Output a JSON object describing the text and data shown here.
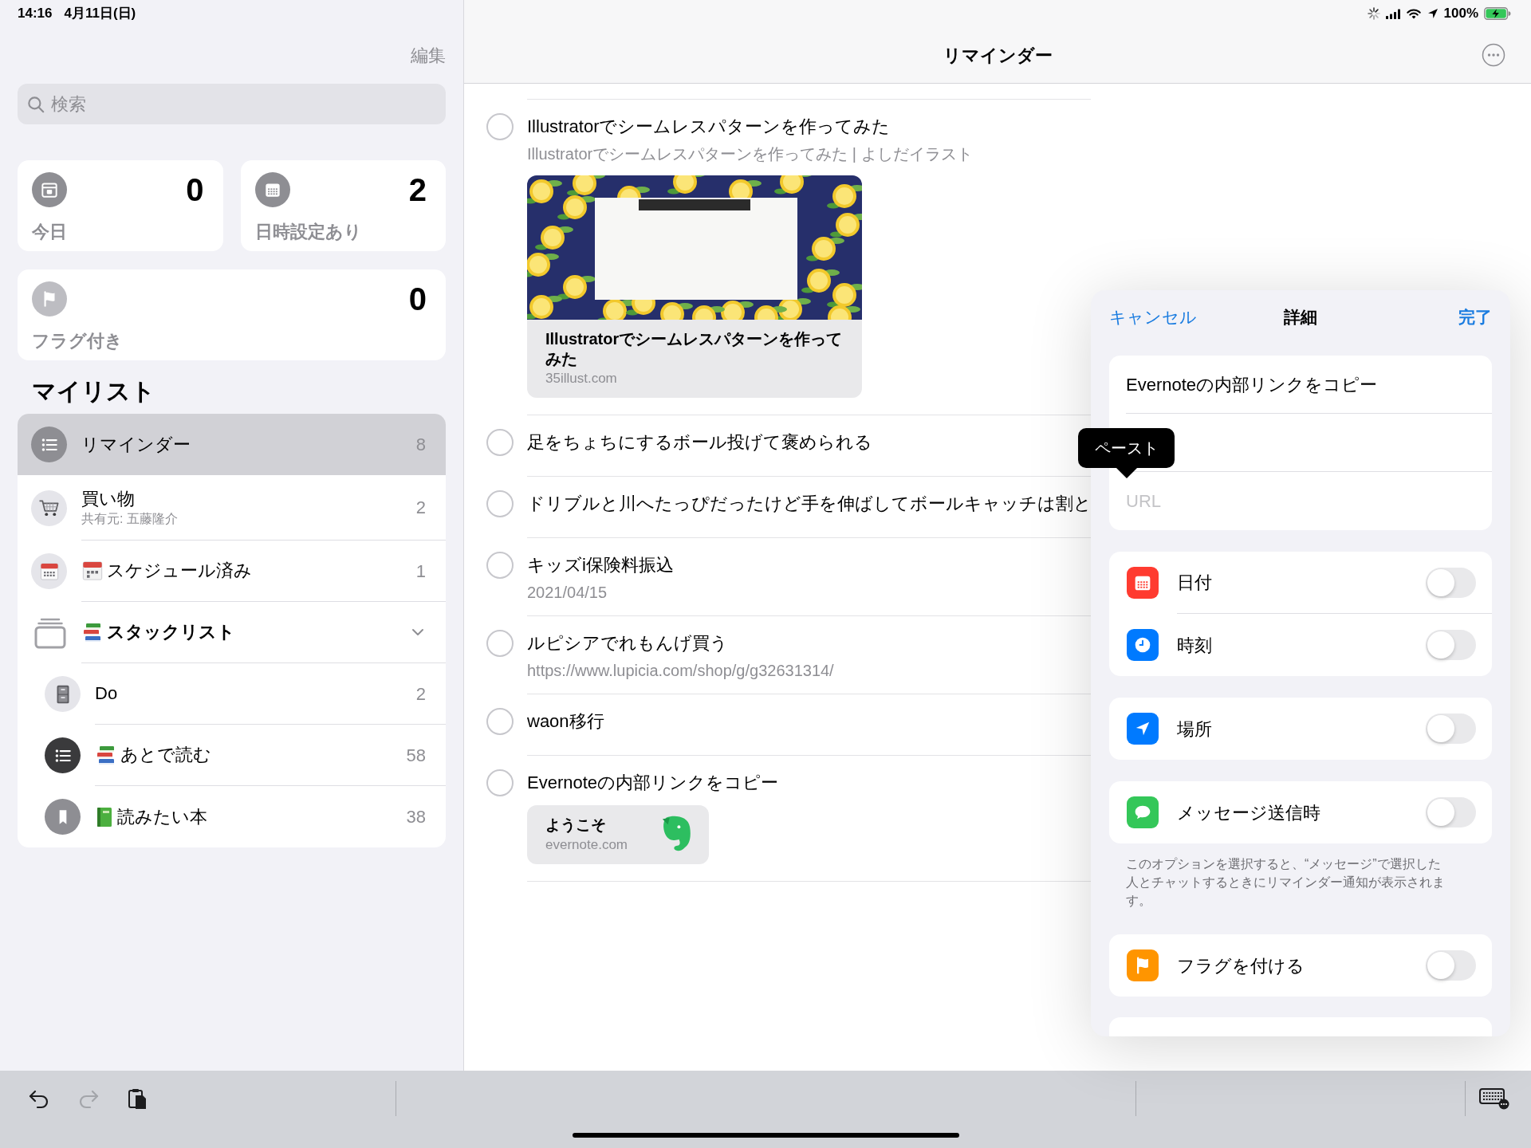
{
  "status_bar": {
    "time": "14:16",
    "date": "4月11日(日)",
    "battery": "100%"
  },
  "sidebar": {
    "edit": {
      "label": "編集",
      "disabled": true
    },
    "search": {
      "placeholder": "検索"
    },
    "smart_lists": [
      {
        "kind": "today",
        "label": "今日",
        "count": "0",
        "color": "#8e8e93"
      },
      {
        "kind": "scheduled",
        "label": "日時設定あり",
        "count": "2",
        "color": "#8e8e93"
      },
      {
        "kind": "flagged",
        "label": "フラグ付き",
        "count": "0",
        "color": "#bdbdc2"
      }
    ],
    "section_title": "マイリスト",
    "lists": [
      {
        "kind": "list",
        "name": "リマインダー",
        "count": "8",
        "selected": true,
        "color": "#8e8e93"
      },
      {
        "kind": "cart",
        "name": "買い物",
        "subtitle": "共有元: 五藤隆介",
        "count": "2",
        "selected": false,
        "color": "#e5e5ea"
      },
      {
        "kind": "calendar",
        "emoji_icon": {
          "kind": "calendar"
        },
        "name": "スケジュール済み",
        "count": "1",
        "selected": false,
        "color": "#e5e5ea"
      },
      {
        "kind": "group",
        "emoji_icon": {
          "kind": "books"
        },
        "name": "スタックリスト",
        "expanded": true,
        "selected": false,
        "children": [
          {
            "kind": "cabinet",
            "name": "Do",
            "count": "2",
            "selected": false,
            "color": "#e5e5ea"
          },
          {
            "kind": "list",
            "emoji_icon": {
              "kind": "books"
            },
            "name": "あとで読む",
            "count": "58",
            "selected": false,
            "color": "#3a3a3c"
          },
          {
            "kind": "bookmark",
            "emoji_icon": {
              "kind": "book"
            },
            "name": "読みたい本",
            "count": "38",
            "selected": false,
            "color": "#8e8e93"
          }
        ]
      }
    ]
  },
  "list_view": {
    "title": "リマインダー",
    "items": [
      {
        "title": "Illustratorでシームレスパターンを作ってみた",
        "completed": false,
        "subtitle": "Illustratorでシームレスパターンを作ってみた | よしだイラスト",
        "link_preview": {
          "kind": "image",
          "title": "Illustratorでシームレスパターンを作ってみた",
          "domain": "35illust.com"
        }
      },
      {
        "title": "足をちょちにするボール投げて褒められる",
        "completed": false
      },
      {
        "title": "ドリブルと川へたっぴだったけど手を伸ばしてボールキャッチは割と",
        "completed": false
      },
      {
        "title": "キッズi保険料振込",
        "completed": false,
        "subtitle": "2021/04/15"
      },
      {
        "title": "ルピシアでれもんげ買う",
        "completed": false,
        "subtitle": "https://www.lupicia.com/shop/g/g32631314/"
      },
      {
        "title": "waon移行",
        "completed": false
      },
      {
        "title": "Evernoteの内部リンクをコピー",
        "completed": false,
        "link_preview": {
          "kind": "compact",
          "title": "ようこそ",
          "domain": "evernote.com"
        }
      }
    ]
  },
  "detail_popover": {
    "cancel": "キャンセル",
    "title": "詳細",
    "done": "完了",
    "reminder_title": "Evernoteの内部リンクをコピー",
    "url": {
      "placeholder": "URL"
    },
    "groups": [
      {
        "rows": [
          {
            "kind": "date",
            "label": "日付",
            "on": false,
            "color": "#ff3b30"
          },
          {
            "kind": "time",
            "label": "時刻",
            "on": false,
            "color": "#007aff"
          }
        ]
      },
      {
        "rows": [
          {
            "kind": "location",
            "label": "場所",
            "on": false,
            "color": "#007aff"
          }
        ]
      },
      {
        "rows": [
          {
            "kind": "messages",
            "label": "メッセージ送信時",
            "on": false,
            "color": "#34c759"
          }
        ],
        "footnote": "このオプションを選択すると、“メッセージ”で選択した人とチャットするときにリマインダー通知が表示されます。"
      },
      {
        "rows": [
          {
            "kind": "flag",
            "label": "フラグを付ける",
            "on": false,
            "color": "#ff9500"
          }
        ]
      }
    ]
  },
  "edit_menu": {
    "items": [
      "ペースト"
    ]
  },
  "toolbar": {
    "buttons": [
      {
        "kind": "undo",
        "disabled": false
      },
      {
        "kind": "redo",
        "disabled": true
      },
      {
        "kind": "clipboard",
        "disabled": false
      },
      {
        "kind": "keyboard",
        "disabled": false
      }
    ]
  }
}
